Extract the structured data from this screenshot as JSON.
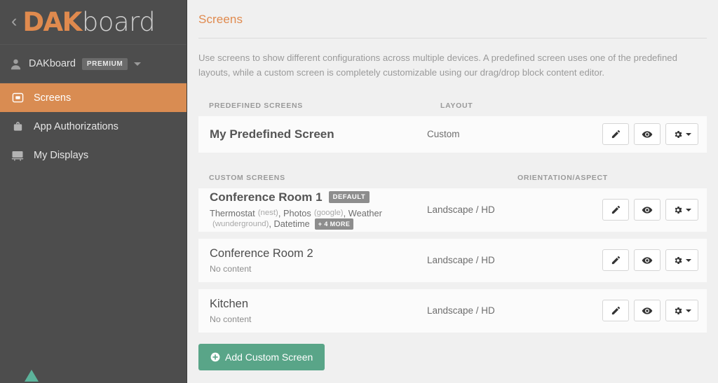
{
  "sidebar": {
    "back_chevron": "‹",
    "logo": {
      "part1": "DAK",
      "part2": "board",
      "mountain_color": "#5cb39b",
      "brand_color": "#e08a4e"
    },
    "user": {
      "name": "DAKboard",
      "badge": "PREMIUM",
      "icon": "user-icon"
    },
    "nav": [
      {
        "label": "Screens",
        "icon": "screen-icon",
        "active": true
      },
      {
        "label": "App Authorizations",
        "icon": "briefcase-lock-icon",
        "active": false
      },
      {
        "label": "My Displays",
        "icon": "monitor-icon",
        "active": false
      }
    ]
  },
  "main": {
    "title": "Screens",
    "description": "Use screens to show different configurations across multiple devices. A predefined screen uses one of the predefined layouts, while a custom screen is completely customizable using our drag/drop block content editor.",
    "predefined": {
      "col_name": "PREDEFINED SCREENS",
      "col_layout": "LAYOUT",
      "rows": [
        {
          "name": "My Predefined Screen",
          "layout": "Custom"
        }
      ]
    },
    "custom": {
      "col_name": "CUSTOM SCREENS",
      "col_orientation": "ORIENTATION/ASPECT",
      "rows": [
        {
          "name": "Conference Room 1",
          "badge": "DEFAULT",
          "contents": [
            {
              "name": "Thermostat",
              "service": "(nest)"
            },
            {
              "name": "Photos",
              "service": "(google)"
            },
            {
              "name": "Weather",
              "service": "(wunderground)"
            },
            {
              "name": "Datetime",
              "service": ""
            }
          ],
          "more_badge": "+ 4 MORE",
          "orientation": "Landscape / HD"
        },
        {
          "name": "Conference Room 2",
          "badge": "",
          "empty_text": "No content",
          "orientation": "Landscape / HD"
        },
        {
          "name": "Kitchen",
          "badge": "",
          "empty_text": "No content",
          "orientation": "Landscape / HD"
        }
      ]
    },
    "add_button": {
      "label": "Add Custom Screen",
      "icon": "plus-circle-icon",
      "color": "#59a588"
    },
    "actions": {
      "edit": "pencil-icon",
      "preview": "eye-icon",
      "settings": "gear-icon"
    }
  }
}
